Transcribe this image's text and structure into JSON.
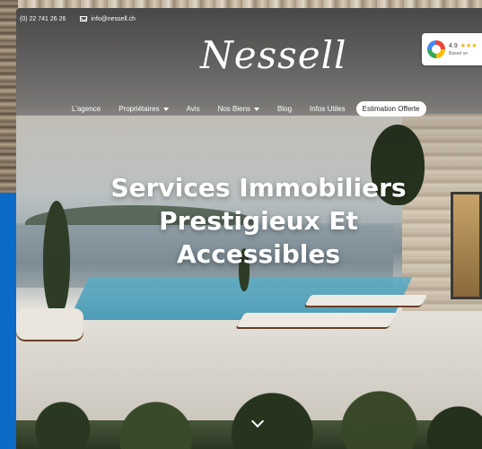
{
  "topbar": {
    "phone": "(0) 22 741 26 26",
    "email": "info@nessell.ch"
  },
  "logo": {
    "text": "Nessell"
  },
  "google_badge": {
    "score": "4.9",
    "stars": "★★★",
    "subtext": "Based on"
  },
  "nav": {
    "items": [
      {
        "label": "L'agence",
        "dropdown": false
      },
      {
        "label": "Propriétaires",
        "dropdown": true
      },
      {
        "label": "Avis",
        "dropdown": false
      },
      {
        "label": "Nos Biens",
        "dropdown": true
      },
      {
        "label": "Blog",
        "dropdown": false
      },
      {
        "label": "Infos Utiles",
        "dropdown": false
      }
    ],
    "cta": "Estimation Offerte"
  },
  "hero": {
    "line1": "Services Immobiliers",
    "line2": "Prestigieux Et",
    "line3": "Accessibles"
  },
  "colors": {
    "side_blue": "#0b6bc6",
    "google_star": "#f4b400"
  },
  "icons": [
    "mail-icon",
    "google-icon",
    "chevron-down-icon",
    "caret-down-icon"
  ]
}
